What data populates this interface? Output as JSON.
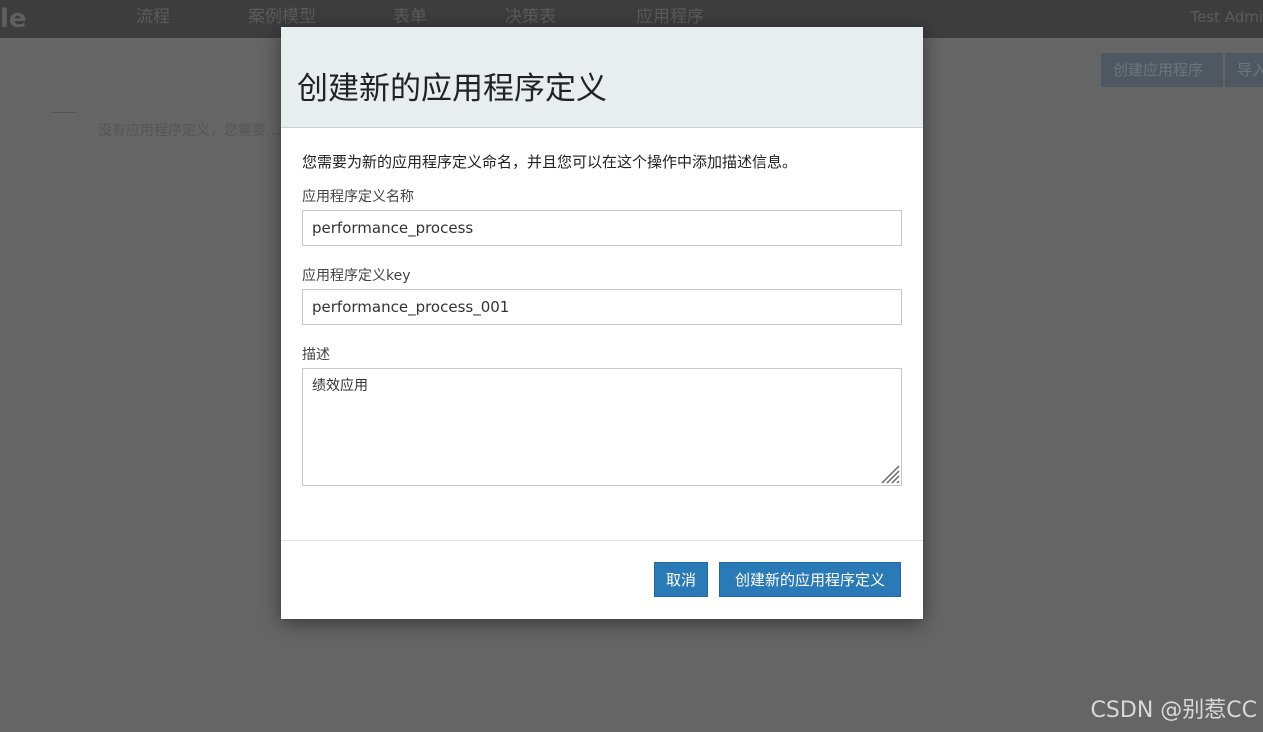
{
  "background": {
    "logo": "le",
    "nav": [
      "流程",
      "案例模型",
      "表单",
      "决策表",
      "应用程序"
    ],
    "user": "Test Admi",
    "buttons": [
      "创建应用程序",
      "导入"
    ],
    "hint": "没有应用程序定义，您需要..."
  },
  "modal": {
    "title": "创建新的应用程序定义",
    "intro": "您需要为新的应用程序定义命名，并且您可以在这个操作中添加描述信息。",
    "name_label": "应用程序定义名称",
    "name_value": "performance_process",
    "key_label": "应用程序定义key",
    "key_value": "performance_process_001",
    "desc_label": "描述",
    "desc_value": "绩效应用",
    "cancel_label": "取消",
    "create_label": "创建新的应用程序定义"
  },
  "watermark": "CSDN @别惹CC",
  "colors": {
    "primary_button": "#2a7ab7",
    "header_bg": "#e8edf0",
    "overlay": "#656565"
  }
}
